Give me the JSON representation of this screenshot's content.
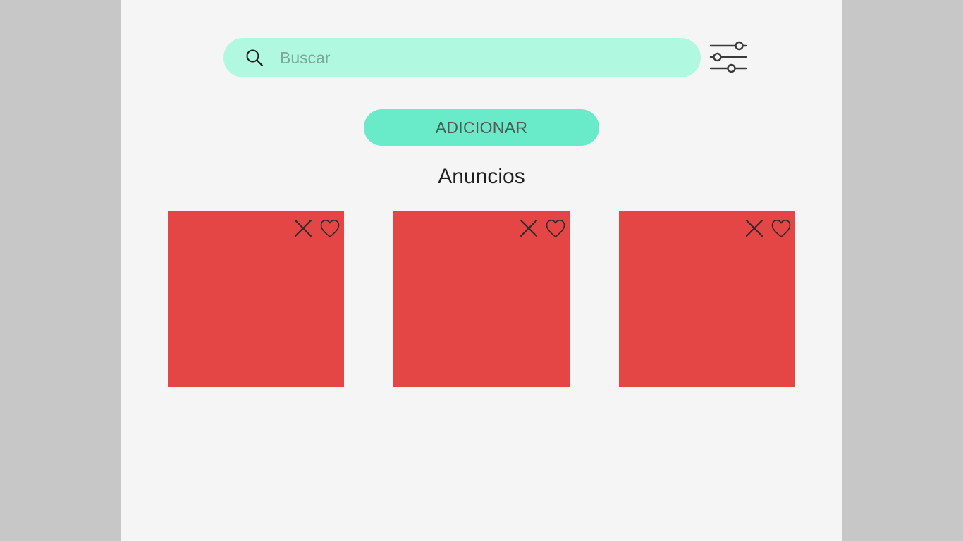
{
  "search": {
    "placeholder": "Buscar",
    "value": ""
  },
  "toolbar": {
    "add_label": "ADICIONAR"
  },
  "section": {
    "title": "Anuncios"
  },
  "cards": [
    {
      "color": "#e44545",
      "remove_icon": "close-icon",
      "favorite_icon": "heart-outline-icon"
    },
    {
      "color": "#e44545",
      "remove_icon": "close-icon",
      "favorite_icon": "heart-outline-icon"
    },
    {
      "color": "#e44545",
      "remove_icon": "close-icon",
      "favorite_icon": "heart-outline-icon"
    }
  ],
  "colors": {
    "page_background": "#f5f5f5",
    "outer_background": "#c7c7c7",
    "search_background": "#b0f9e0",
    "accent": "#69ebc9",
    "card": "#e44545"
  }
}
